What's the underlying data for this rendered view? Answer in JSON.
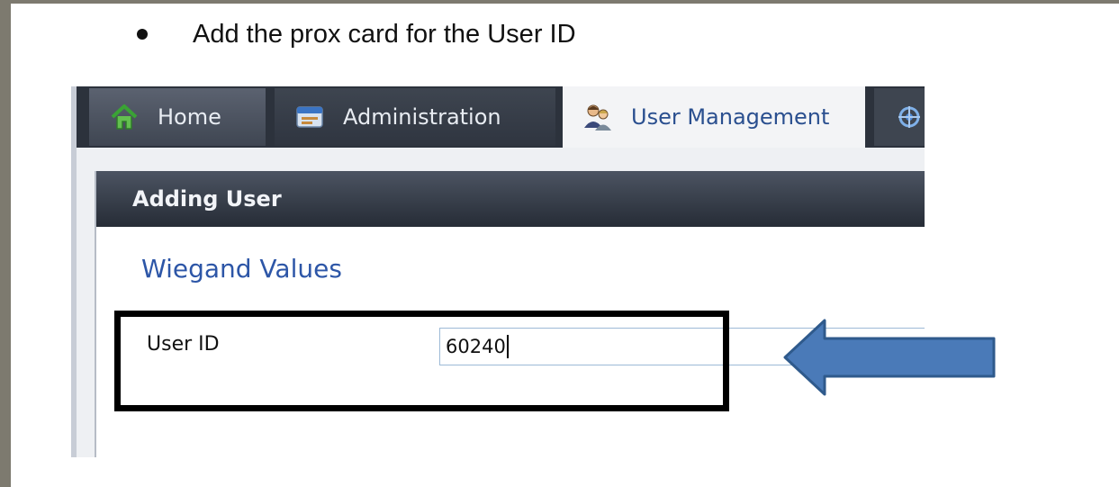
{
  "instruction": {
    "text": "Add the prox card for the User ID"
  },
  "tabs": [
    {
      "label": "Home",
      "icon": "home-icon"
    },
    {
      "label": "Administration",
      "icon": "administration-icon"
    },
    {
      "label": "User Management",
      "icon": "users-icon",
      "active": true
    },
    {
      "label": "",
      "icon": "network-icon"
    }
  ],
  "panel": {
    "title": "Adding User",
    "section_title": "Wiegand Values",
    "field": {
      "label": "User ID",
      "value": "60240"
    }
  },
  "colors": {
    "tab_bar": "#2c323c",
    "active_tab_text": "#2a4f8f",
    "section_title": "#2d56a7",
    "arrow_fill": "#4a7ab8",
    "arrow_stroke": "#2f5a8c"
  }
}
